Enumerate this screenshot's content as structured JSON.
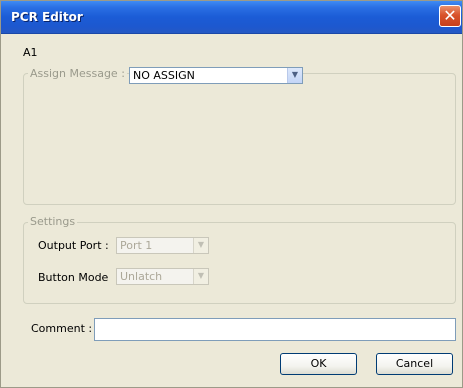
{
  "window": {
    "title": "PCR Editor",
    "close_glyph": "✕"
  },
  "cell_label": "A1",
  "assign_group": {
    "legend": "Assign Message :",
    "selected": "NO ASSIGN",
    "arrow_glyph": "▼"
  },
  "settings_group": {
    "legend": "Settings",
    "output_port": {
      "label": "Output Port :",
      "value": "Port 1",
      "arrow_glyph": "▼"
    },
    "button_mode": {
      "label": "Button Mode",
      "value": "Unlatch",
      "arrow_glyph": "▼"
    }
  },
  "comment": {
    "label": "Comment :",
    "value": ""
  },
  "buttons": {
    "ok": "OK",
    "cancel": "Cancel"
  },
  "colors": {
    "titlebar": "#1b5cd6",
    "close": "#d9532b",
    "dialog_bg": "#ece9d8"
  }
}
